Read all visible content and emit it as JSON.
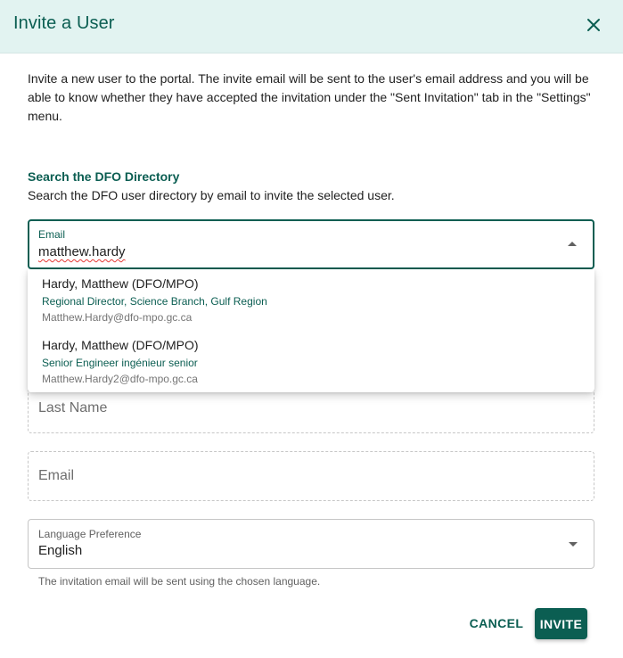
{
  "dialog": {
    "title": "Invite a User",
    "close_icon": "close-icon",
    "intro": "Invite a new user to the portal. The invite email will be sent to the user's email address and you will be able to know whether they have accepted the invitation under the \"Sent Invitation\" tab in the \"Settings\" menu."
  },
  "directory": {
    "title": "Search the DFO Directory",
    "description": "Search the DFO user directory by email to invite the selected user."
  },
  "email_search": {
    "label": "Email",
    "value": "matthew.hardy"
  },
  "results": [
    {
      "name": "Hardy, Matthew (DFO/MPO)",
      "role": "Regional Director, Science Branch, Gulf Region",
      "email": "Matthew.Hardy@dfo-mpo.gc.ca"
    },
    {
      "name": "Hardy, Matthew (DFO/MPO)",
      "role": "Senior Engineer ingénieur senior",
      "email": "Matthew.Hardy2@dfo-mpo.gc.ca"
    }
  ],
  "last_name": {
    "placeholder": "Last Name"
  },
  "email_field": {
    "placeholder": "Email"
  },
  "language": {
    "label": "Language Preference",
    "value": "English",
    "hint": "The invitation email will be sent using the chosen language."
  },
  "actions": {
    "cancel": "CANCEL",
    "invite": "INVITE"
  },
  "colors": {
    "accent": "#0b5e52",
    "header_bg": "#e2f3f1"
  }
}
